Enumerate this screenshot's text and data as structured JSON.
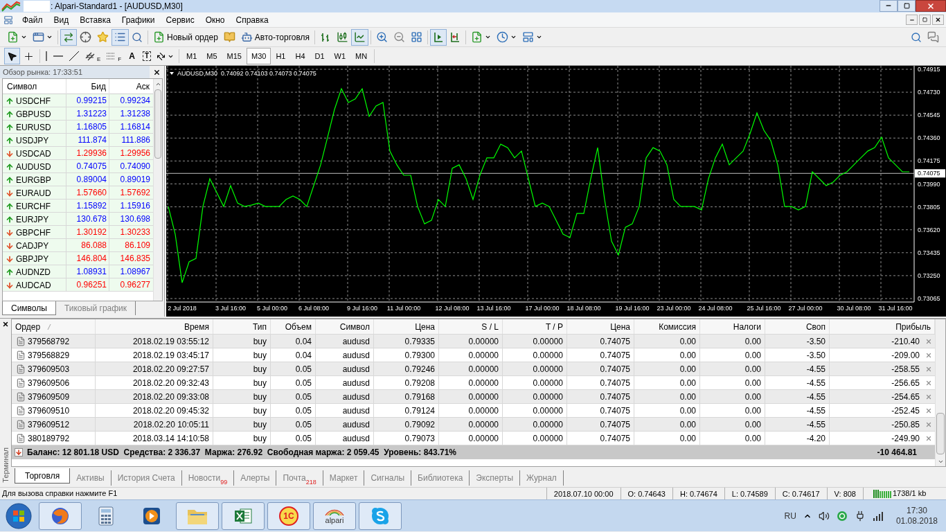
{
  "window": {
    "title": ": Alpari-Standard1 - [AUDUSD,M30]"
  },
  "menu": [
    "Файл",
    "Вид",
    "Вставка",
    "Графики",
    "Сервис",
    "Окно",
    "Справка"
  ],
  "toolbar": {
    "market_watch_on": true,
    "terminal_on": true,
    "new_order": "Новый ордер",
    "auto_trading": "Авто-торговля",
    "line_chart_on": true,
    "autoscroll_on": true
  },
  "drawing_tools": {
    "cursor_on": true,
    "channel_mark": "E",
    "fibo_mark": "F",
    "text_tool": "A",
    "label_tool": "T"
  },
  "timeframes": [
    {
      "label": "M1",
      "selected": false
    },
    {
      "label": "M5",
      "selected": false
    },
    {
      "label": "M15",
      "selected": false
    },
    {
      "label": "M30",
      "selected": true
    },
    {
      "label": "H1",
      "selected": false
    },
    {
      "label": "H4",
      "selected": false
    },
    {
      "label": "D1",
      "selected": false
    },
    {
      "label": "W1",
      "selected": false
    },
    {
      "label": "MN",
      "selected": false
    }
  ],
  "market_watch": {
    "title": "Обзор рынка: 17:33:51",
    "columns": [
      "Символ",
      "Бид",
      "Аск"
    ],
    "rows": [
      {
        "symbol": "USDCHF",
        "bid": "0.99215",
        "ask": "0.99234",
        "rising": true
      },
      {
        "symbol": "GBPUSD",
        "bid": "1.31223",
        "ask": "1.31238",
        "rising": true
      },
      {
        "symbol": "EURUSD",
        "bid": "1.16805",
        "ask": "1.16814",
        "rising": true
      },
      {
        "symbol": "USDJPY",
        "bid": "111.874",
        "ask": "111.886",
        "rising": true
      },
      {
        "symbol": "USDCAD",
        "bid": "1.29936",
        "ask": "1.29956",
        "rising": false
      },
      {
        "symbol": "AUDUSD",
        "bid": "0.74075",
        "ask": "0.74090",
        "rising": true
      },
      {
        "symbol": "EURGBP",
        "bid": "0.89004",
        "ask": "0.89019",
        "rising": true
      },
      {
        "symbol": "EURAUD",
        "bid": "1.57660",
        "ask": "1.57692",
        "rising": false
      },
      {
        "symbol": "EURCHF",
        "bid": "1.15892",
        "ask": "1.15916",
        "rising": true
      },
      {
        "symbol": "EURJPY",
        "bid": "130.678",
        "ask": "130.698",
        "rising": true
      },
      {
        "symbol": "GBPCHF",
        "bid": "1.30192",
        "ask": "1.30233",
        "rising": false
      },
      {
        "symbol": "CADJPY",
        "bid": "86.088",
        "ask": "86.109",
        "rising": false
      },
      {
        "symbol": "GBPJPY",
        "bid": "146.804",
        "ask": "146.835",
        "rising": false
      },
      {
        "symbol": "AUDNZD",
        "bid": "1.08931",
        "ask": "1.08967",
        "rising": true
      },
      {
        "symbol": "AUDCAD",
        "bid": "0.96251",
        "ask": "0.96277",
        "rising": false
      }
    ],
    "tabs": [
      {
        "label": "Символы",
        "selected": true
      },
      {
        "label": "Тиковый график",
        "selected": false
      }
    ]
  },
  "chart": {
    "chart_data": {
      "type": "line",
      "title": "AUDUSD,M30  0.74092 0.74103 0.74073 0.74075",
      "categories": [
        null,
        null,
        "2 Jul 2018",
        null,
        null,
        null,
        null,
        null,
        null,
        "3 Jul 16:00",
        null,
        null,
        null,
        null,
        null,
        "5 Jul 00:00",
        null,
        null,
        null,
        null,
        null,
        "6 Jul 08:00",
        null,
        null,
        null,
        null,
        null,
        null,
        "9 Jul 16:00",
        null,
        null,
        null,
        null,
        null,
        "11 Jul 00:00",
        null,
        null,
        null,
        null,
        null,
        null,
        "12 Jul 08:00",
        null,
        null,
        null,
        null,
        null,
        "13 Jul 16:00",
        null,
        null,
        null,
        null,
        null,
        null,
        "17 Jul 00:00",
        null,
        null,
        null,
        null,
        null,
        "18 Jul 08:00",
        null,
        null,
        null,
        null,
        null,
        null,
        "19 Jul 16:00",
        null,
        null,
        null,
        null,
        null,
        "23 Jul 00:00",
        null,
        null,
        null,
        null,
        null,
        "24 Jul 08:00",
        null,
        null,
        null,
        null,
        null,
        null,
        "25 Jul 16:00",
        null,
        null,
        null,
        null,
        null,
        "27 Jul 00:00",
        null,
        null,
        null,
        null,
        null,
        null,
        "30 Jul 08:00",
        null,
        null,
        null,
        null,
        null,
        "31 Jul 16:00",
        null,
        null
      ],
      "grid": true,
      "series": [
        {
          "color": "#00ff00",
          "values": [
            0.73808,
            0.73585,
            0.73193,
            0.73361,
            0.73389,
            0.73808,
            0.74032,
            0.7392,
            0.73808,
            0.73976,
            0.73836,
            0.73808,
            0.73819,
            0.73836,
            0.73808,
            0.73808,
            0.73808,
            0.73864,
            0.73892,
            0.73864,
            0.73808,
            0.73976,
            0.74144,
            0.74367,
            0.74591,
            0.74758,
            0.74647,
            0.74675,
            0.74758,
            0.74535,
            0.74619,
            0.74647,
            0.74255,
            0.74144,
            0.7406,
            0.7406,
            0.73808,
            0.73668,
            0.73696,
            0.73864,
            0.73808,
            0.74116,
            0.74144,
            0.74032,
            0.73864,
            0.7406,
            0.742,
            0.742,
            0.74311,
            0.74283,
            0.742,
            0.74255,
            0.74032,
            0.73808,
            0.73836,
            0.73808,
            0.73696,
            0.73585,
            0.73557,
            0.73752,
            0.73752,
            0.74032,
            0.74283,
            0.73864,
            0.73529,
            0.73417,
            0.7364,
            0.73668,
            0.73808,
            0.742,
            0.74283,
            0.74255,
            0.74144,
            0.73864,
            0.73808,
            0.73808,
            0.73808,
            0.7378,
            0.74032,
            0.742,
            0.74311,
            0.74144,
            0.742,
            0.74255,
            0.74395,
            0.74563,
            0.74423,
            0.74339,
            0.74144,
            0.73808,
            0.73808,
            0.7378,
            0.73808,
            0.74088,
            0.74032,
            0.73976,
            0.74004,
            0.7406,
            0.74088,
            0.74144,
            0.742,
            0.74255,
            0.74283,
            0.74367,
            0.742,
            0.74144,
            0.74088,
            0.74088
          ]
        }
      ],
      "ylim": [
        0.73037,
        0.74943
      ],
      "yticks": [
        {
          "value": 0.74915,
          "label": "0.74915"
        },
        {
          "value": 0.7473,
          "label": "0.74730"
        },
        {
          "value": 0.74545,
          "label": "0.74545"
        },
        {
          "value": 0.7436,
          "label": "0.74360"
        },
        {
          "value": 0.74175,
          "label": "0.74175"
        },
        {
          "value": 0.7399,
          "label": "0.73990"
        },
        {
          "value": 0.73805,
          "label": "0.73805"
        },
        {
          "value": 0.7362,
          "label": "0.73620"
        },
        {
          "value": 0.73435,
          "label": "0.73435"
        },
        {
          "value": 0.7325,
          "label": "0.73250"
        },
        {
          "value": 0.73065,
          "label": "0.73065"
        }
      ],
      "ref_lines": [
        {
          "axis": "y",
          "value": 0.74075,
          "label": "0.74075"
        }
      ]
    }
  },
  "terminal": {
    "label": "Терминал",
    "columns": [
      "Ордер",
      "Время",
      "Тип",
      "Объем",
      "Символ",
      "Цена",
      "S / L",
      "T / P",
      "Цена",
      "Комиссия",
      "Налоги",
      "Своп",
      "Прибыль"
    ],
    "rows": [
      [
        "379568792",
        "2018.02.19 03:55:12",
        "buy",
        "0.04",
        "audusd",
        "0.79335",
        "0.00000",
        "0.00000",
        "0.74075",
        "0.00",
        "0.00",
        "-3.50",
        "-210.40"
      ],
      [
        "379568829",
        "2018.02.19 03:45:17",
        "buy",
        "0.04",
        "audusd",
        "0.79300",
        "0.00000",
        "0.00000",
        "0.74075",
        "0.00",
        "0.00",
        "-3.50",
        "-209.00"
      ],
      [
        "379609503",
        "2018.02.20 09:27:57",
        "buy",
        "0.05",
        "audusd",
        "0.79246",
        "0.00000",
        "0.00000",
        "0.74075",
        "0.00",
        "0.00",
        "-4.55",
        "-258.55"
      ],
      [
        "379609506",
        "2018.02.20 09:32:43",
        "buy",
        "0.05",
        "audusd",
        "0.79208",
        "0.00000",
        "0.00000",
        "0.74075",
        "0.00",
        "0.00",
        "-4.55",
        "-256.65"
      ],
      [
        "379609509",
        "2018.02.20 09:33:08",
        "buy",
        "0.05",
        "audusd",
        "0.79168",
        "0.00000",
        "0.00000",
        "0.74075",
        "0.00",
        "0.00",
        "-4.55",
        "-254.65"
      ],
      [
        "379609510",
        "2018.02.20 09:45:32",
        "buy",
        "0.05",
        "audusd",
        "0.79124",
        "0.00000",
        "0.00000",
        "0.74075",
        "0.00",
        "0.00",
        "-4.55",
        "-252.45"
      ],
      [
        "379609512",
        "2018.02.20 10:05:11",
        "buy",
        "0.05",
        "audusd",
        "0.79092",
        "0.00000",
        "0.00000",
        "0.74075",
        "0.00",
        "0.00",
        "-4.55",
        "-250.85"
      ],
      [
        "380189792",
        "2018.03.14 14:10:58",
        "buy",
        "0.05",
        "audusd",
        "0.79073",
        "0.00000",
        "0.00000",
        "0.74075",
        "0.00",
        "0.00",
        "-4.20",
        "-249.90"
      ]
    ],
    "summary": {
      "text": "Баланс: 12 801.18 USD  Средства: 2 336.37  Маржа: 276.92  Свободная маржа: 2 059.45  Уровень: 843.71%",
      "total": "-10 464.81"
    },
    "tabs": [
      {
        "label": "Торговля",
        "selected": true
      },
      {
        "label": "Активы",
        "selected": false
      },
      {
        "label": "История Счета",
        "selected": false
      },
      {
        "label": "Новости",
        "badge": "99",
        "selected": false
      },
      {
        "label": "Алерты",
        "selected": false
      },
      {
        "label": "Почта",
        "badge": "218",
        "selected": false
      },
      {
        "label": "Маркет",
        "selected": false
      },
      {
        "label": "Сигналы",
        "selected": false
      },
      {
        "label": "Библиотека",
        "selected": false
      },
      {
        "label": "Эксперты",
        "selected": false
      },
      {
        "label": "Журнал",
        "selected": false
      }
    ]
  },
  "status_bar": {
    "help": "Для вызова справки нажмите F1",
    "fields": [
      "2018.07.10 00:00",
      "O: 0.74643",
      "H: 0.74674",
      "L: 0.74589",
      "C: 0.74617",
      "V: 808"
    ],
    "traffic": "1738/1 kb"
  },
  "taskbar": {
    "apps": [
      {
        "kind": "browser",
        "running": true
      },
      {
        "kind": "calculator",
        "running": false
      },
      {
        "kind": "media",
        "running": false
      },
      {
        "kind": "explorer",
        "running": true
      },
      {
        "kind": "spreadsheet",
        "running": true
      },
      {
        "kind": "onec",
        "label": "1С",
        "running": true
      },
      {
        "kind": "alpari",
        "label": "alpari",
        "running": true
      },
      {
        "kind": "skype",
        "running": true
      }
    ],
    "language": "RU",
    "time": "17:30",
    "date": "01.08.2018"
  }
}
